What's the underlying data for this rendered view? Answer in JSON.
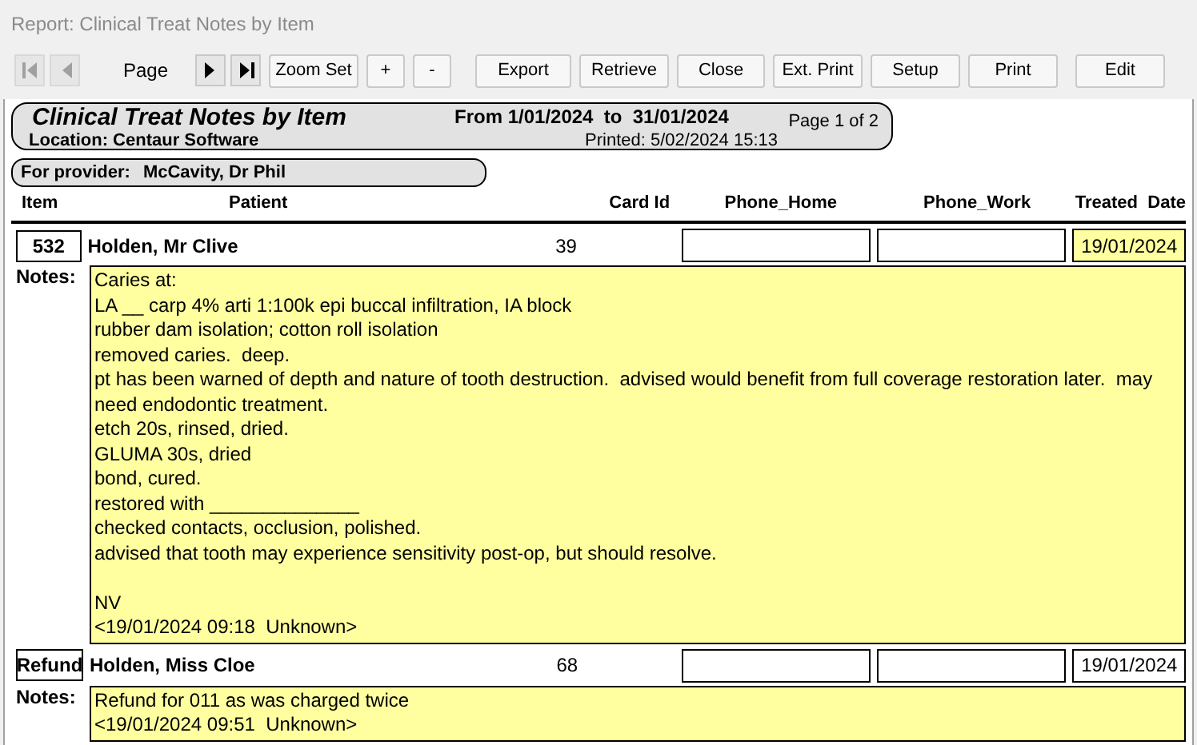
{
  "window": {
    "title": "Report: Clinical Treat Notes by Item"
  },
  "toolbar": {
    "nav": [
      {
        "kind": "first",
        "disabled": true
      },
      {
        "kind": "prev",
        "disabled": true
      },
      {
        "kind": "label",
        "text": "Page"
      },
      {
        "kind": "next",
        "disabled": false
      },
      {
        "kind": "last",
        "disabled": false
      }
    ],
    "buttons": [
      "Zoom Set",
      "+",
      "-",
      "Export",
      "Retrieve",
      "Close",
      "Ext. Print",
      "Setup",
      "Print",
      "Edit"
    ]
  },
  "header": {
    "title": "Clinical Treat Notes by Item",
    "location": "Location: Centaur Software",
    "range": "From 1/01/2024  to  31/01/2024",
    "page": "Page 1 of 2",
    "printed": "Printed: 5/02/2024 15:13"
  },
  "provider": {
    "label": "For provider:",
    "name": "McCavity, Dr Phil"
  },
  "columns": [
    "Item",
    "Patient",
    "Card Id",
    "Phone_Home",
    "Phone_Work",
    "Treated  Date"
  ],
  "records": [
    {
      "item": "532",
      "patient": "Holden, Mr Clive",
      "card_id": "39",
      "date": "19/01/2024",
      "date_highlight": true,
      "notes_label": "Notes:",
      "notes": [
        {
          "text": "Caries at:"
        },
        {
          "text": "LA __ carp 4% arti 1:100k epi buccal infiltration, IA block"
        },
        {
          "text": "rubber dam isolation; cotton roll isolation"
        },
        {
          "text": "removed caries.  deep."
        },
        {
          "text": "pt has been warned of depth and nature of tooth destruction.  advised would benefit from full coverage restoration later.  may need endodontic treatment."
        },
        {
          "text": "etch 20s, rinsed, dried."
        },
        {
          "text": "GLUMA 30s, dried"
        },
        {
          "text": "bond, cured."
        },
        {
          "text": "restored with ______________"
        },
        {
          "text": "checked contacts, occlusion, polished."
        },
        {
          "text": "advised that tooth may experience sensitivity post-op, but should resolve."
        },
        {
          "text": "NV",
          "gap_before": true
        },
        {
          "text": "<19/01/2024 09:18  Unknown>"
        }
      ]
    },
    {
      "item": "Refund",
      "patient": "Holden, Miss Cloe",
      "card_id": "68",
      "date": "19/01/2024",
      "date_highlight": false,
      "notes_label": "Notes:",
      "notes": [
        {
          "text": "Refund for 011 as was charged twice"
        },
        {
          "text": "<19/01/2024 09:51  Unknown>"
        }
      ]
    }
  ]
}
